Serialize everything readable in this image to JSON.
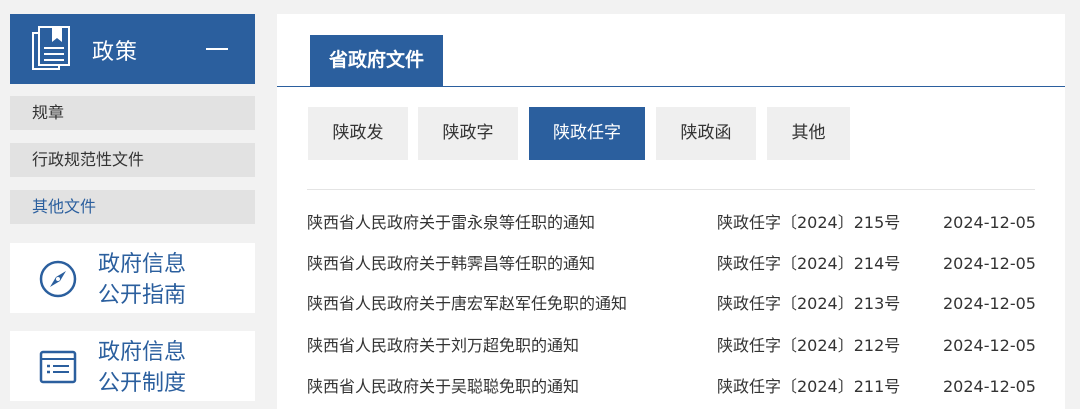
{
  "sidebar": {
    "policy_title": "政策",
    "sub_items": [
      {
        "label": "规章",
        "active": false
      },
      {
        "label": "行政规范性文件",
        "active": false
      },
      {
        "label": "其他文件",
        "active": true
      }
    ],
    "cards": [
      {
        "line1": "政府信息",
        "line2": "公开指南",
        "icon": "compass-icon"
      },
      {
        "line1": "政府信息",
        "line2": "公开制度",
        "icon": "list-document-icon"
      }
    ]
  },
  "main": {
    "tab_title": "省政府文件",
    "subtabs": [
      {
        "label": "陕政发",
        "active": false
      },
      {
        "label": "陕政字",
        "active": false
      },
      {
        "label": "陕政任字",
        "active": true
      },
      {
        "label": "陕政函",
        "active": false
      },
      {
        "label": "其他",
        "active": false
      }
    ],
    "documents": [
      {
        "title": "陕西省人民政府关于雷永泉等任职的通知",
        "number": "陕政任字〔2024〕215号",
        "date": "2024-12-05"
      },
      {
        "title": "陕西省人民政府关于韩霁昌等任职的通知",
        "number": "陕政任字〔2024〕214号",
        "date": "2024-12-05"
      },
      {
        "title": "陕西省人民政府关于唐宏军赵军任免职的通知",
        "number": "陕政任字〔2024〕213号",
        "date": "2024-12-05"
      },
      {
        "title": "陕西省人民政府关于刘万超免职的通知",
        "number": "陕政任字〔2024〕212号",
        "date": "2024-12-05"
      },
      {
        "title": "陕西省人民政府关于吴聪聪免职的通知",
        "number": "陕政任字〔2024〕211号",
        "date": "2024-12-05"
      }
    ]
  },
  "colors": {
    "accent": "#2b5f9e",
    "page_bg": "#f2f2f2",
    "tab_bg": "#efefef"
  }
}
